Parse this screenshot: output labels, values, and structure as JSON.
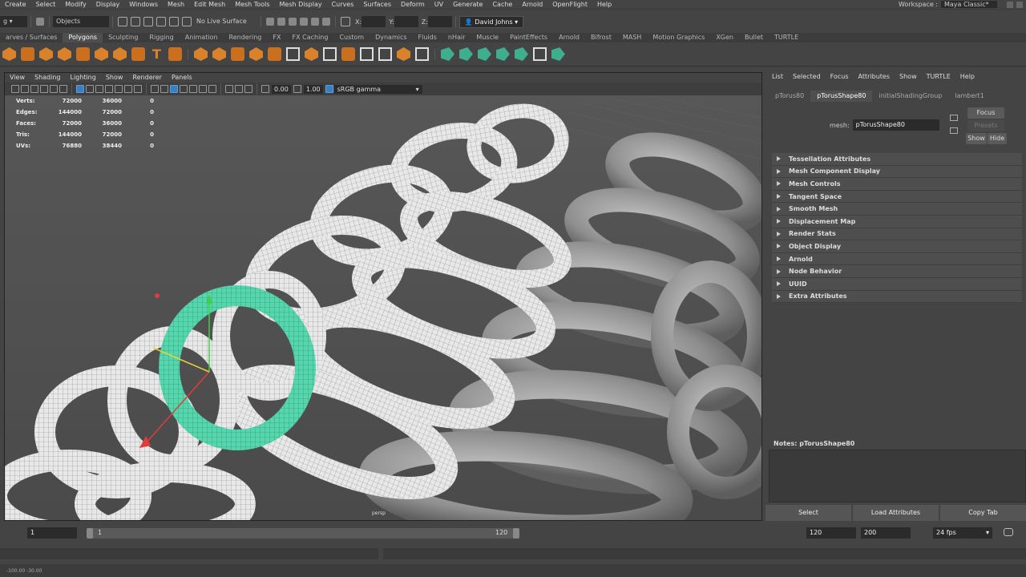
{
  "menubar": {
    "items": [
      "Create",
      "Select",
      "Modify",
      "Display",
      "Windows",
      "Mesh",
      "Edit Mesh",
      "Mesh Tools",
      "Mesh Display",
      "Curves",
      "Surfaces",
      "Deform",
      "UV",
      "Generate",
      "Cache",
      "Arnold",
      "OpenFlight",
      "Help"
    ],
    "workspace_label": "Workspace :",
    "workspace_value": "Maya Classic*"
  },
  "statusline": {
    "select_mode": "Objects",
    "live_surface": "No Live Surface",
    "x_label": "X:",
    "y_label": "Y:",
    "z_label": "Z:",
    "user": "David Johns"
  },
  "shelf": {
    "tabs": [
      "arves / Surfaces",
      "Polygons",
      "Sculpting",
      "Rigging",
      "Animation",
      "Rendering",
      "FX",
      "FX Caching",
      "Custom",
      "Dynamics",
      "Fluids",
      "nHair",
      "Muscle",
      "PaintEffects",
      "Arnold",
      "Bifrost",
      "MASH",
      "Motion Graphics",
      "XGen",
      "Bullet",
      "TURTLE"
    ],
    "active_tab": "Polygons"
  },
  "viewport": {
    "menu": [
      "View",
      "Shading",
      "Lighting",
      "Show",
      "Renderer",
      "Panels"
    ],
    "exposure": "0.00",
    "gamma_value": "1.00",
    "color_space": "sRGB gamma",
    "camera": "persp",
    "hud": {
      "rows": [
        {
          "label": "Verts:",
          "c1": "72000",
          "c2": "36000",
          "c3": "0"
        },
        {
          "label": "Edges:",
          "c1": "144000",
          "c2": "72000",
          "c3": "0"
        },
        {
          "label": "Faces:",
          "c1": "72000",
          "c2": "36000",
          "c3": "0"
        },
        {
          "label": "Tris:",
          "c1": "144000",
          "c2": "72000",
          "c3": "0"
        },
        {
          "label": "UVs:",
          "c1": "76880",
          "c2": "38440",
          "c3": "0"
        }
      ]
    }
  },
  "attribute_editor": {
    "menu": [
      "List",
      "Selected",
      "Focus",
      "Attributes",
      "Show",
      "TURTLE",
      "Help"
    ],
    "tabs": [
      "pTorus80",
      "pTorusShape80",
      "initialShadingGroup",
      "lambert1"
    ],
    "active_tab": "pTorusShape80",
    "focus_label": "Focus",
    "presets_label": "Presets",
    "show_label": "Show",
    "hide_label": "Hide",
    "mesh_label": "mesh:",
    "mesh_value": "pTorusShape80",
    "sections": [
      "Tessellation Attributes",
      "Mesh Component Display",
      "Mesh Controls",
      "Tangent Space",
      "Smooth Mesh",
      "Displacement Map",
      "Render Stats",
      "Object Display",
      "Arnold",
      "Node Behavior",
      "UUID",
      "Extra Attributes"
    ],
    "notes_label": "Notes:  pTorusShape80",
    "bottom_buttons": [
      "Select",
      "Load Attributes",
      "Copy Tab"
    ]
  },
  "timeslider": {
    "start_frame": "1",
    "range_start": "1",
    "range_end": "120",
    "end_frame": "120",
    "anim_end": "200",
    "fps": "24 fps"
  },
  "helpline": {
    "left_values": "-100.00     -30.00"
  },
  "colors": {
    "selected_torus": "#3fbf9a",
    "active_blue": "#3b7fbf",
    "shelf_orange": "#d9822b"
  }
}
